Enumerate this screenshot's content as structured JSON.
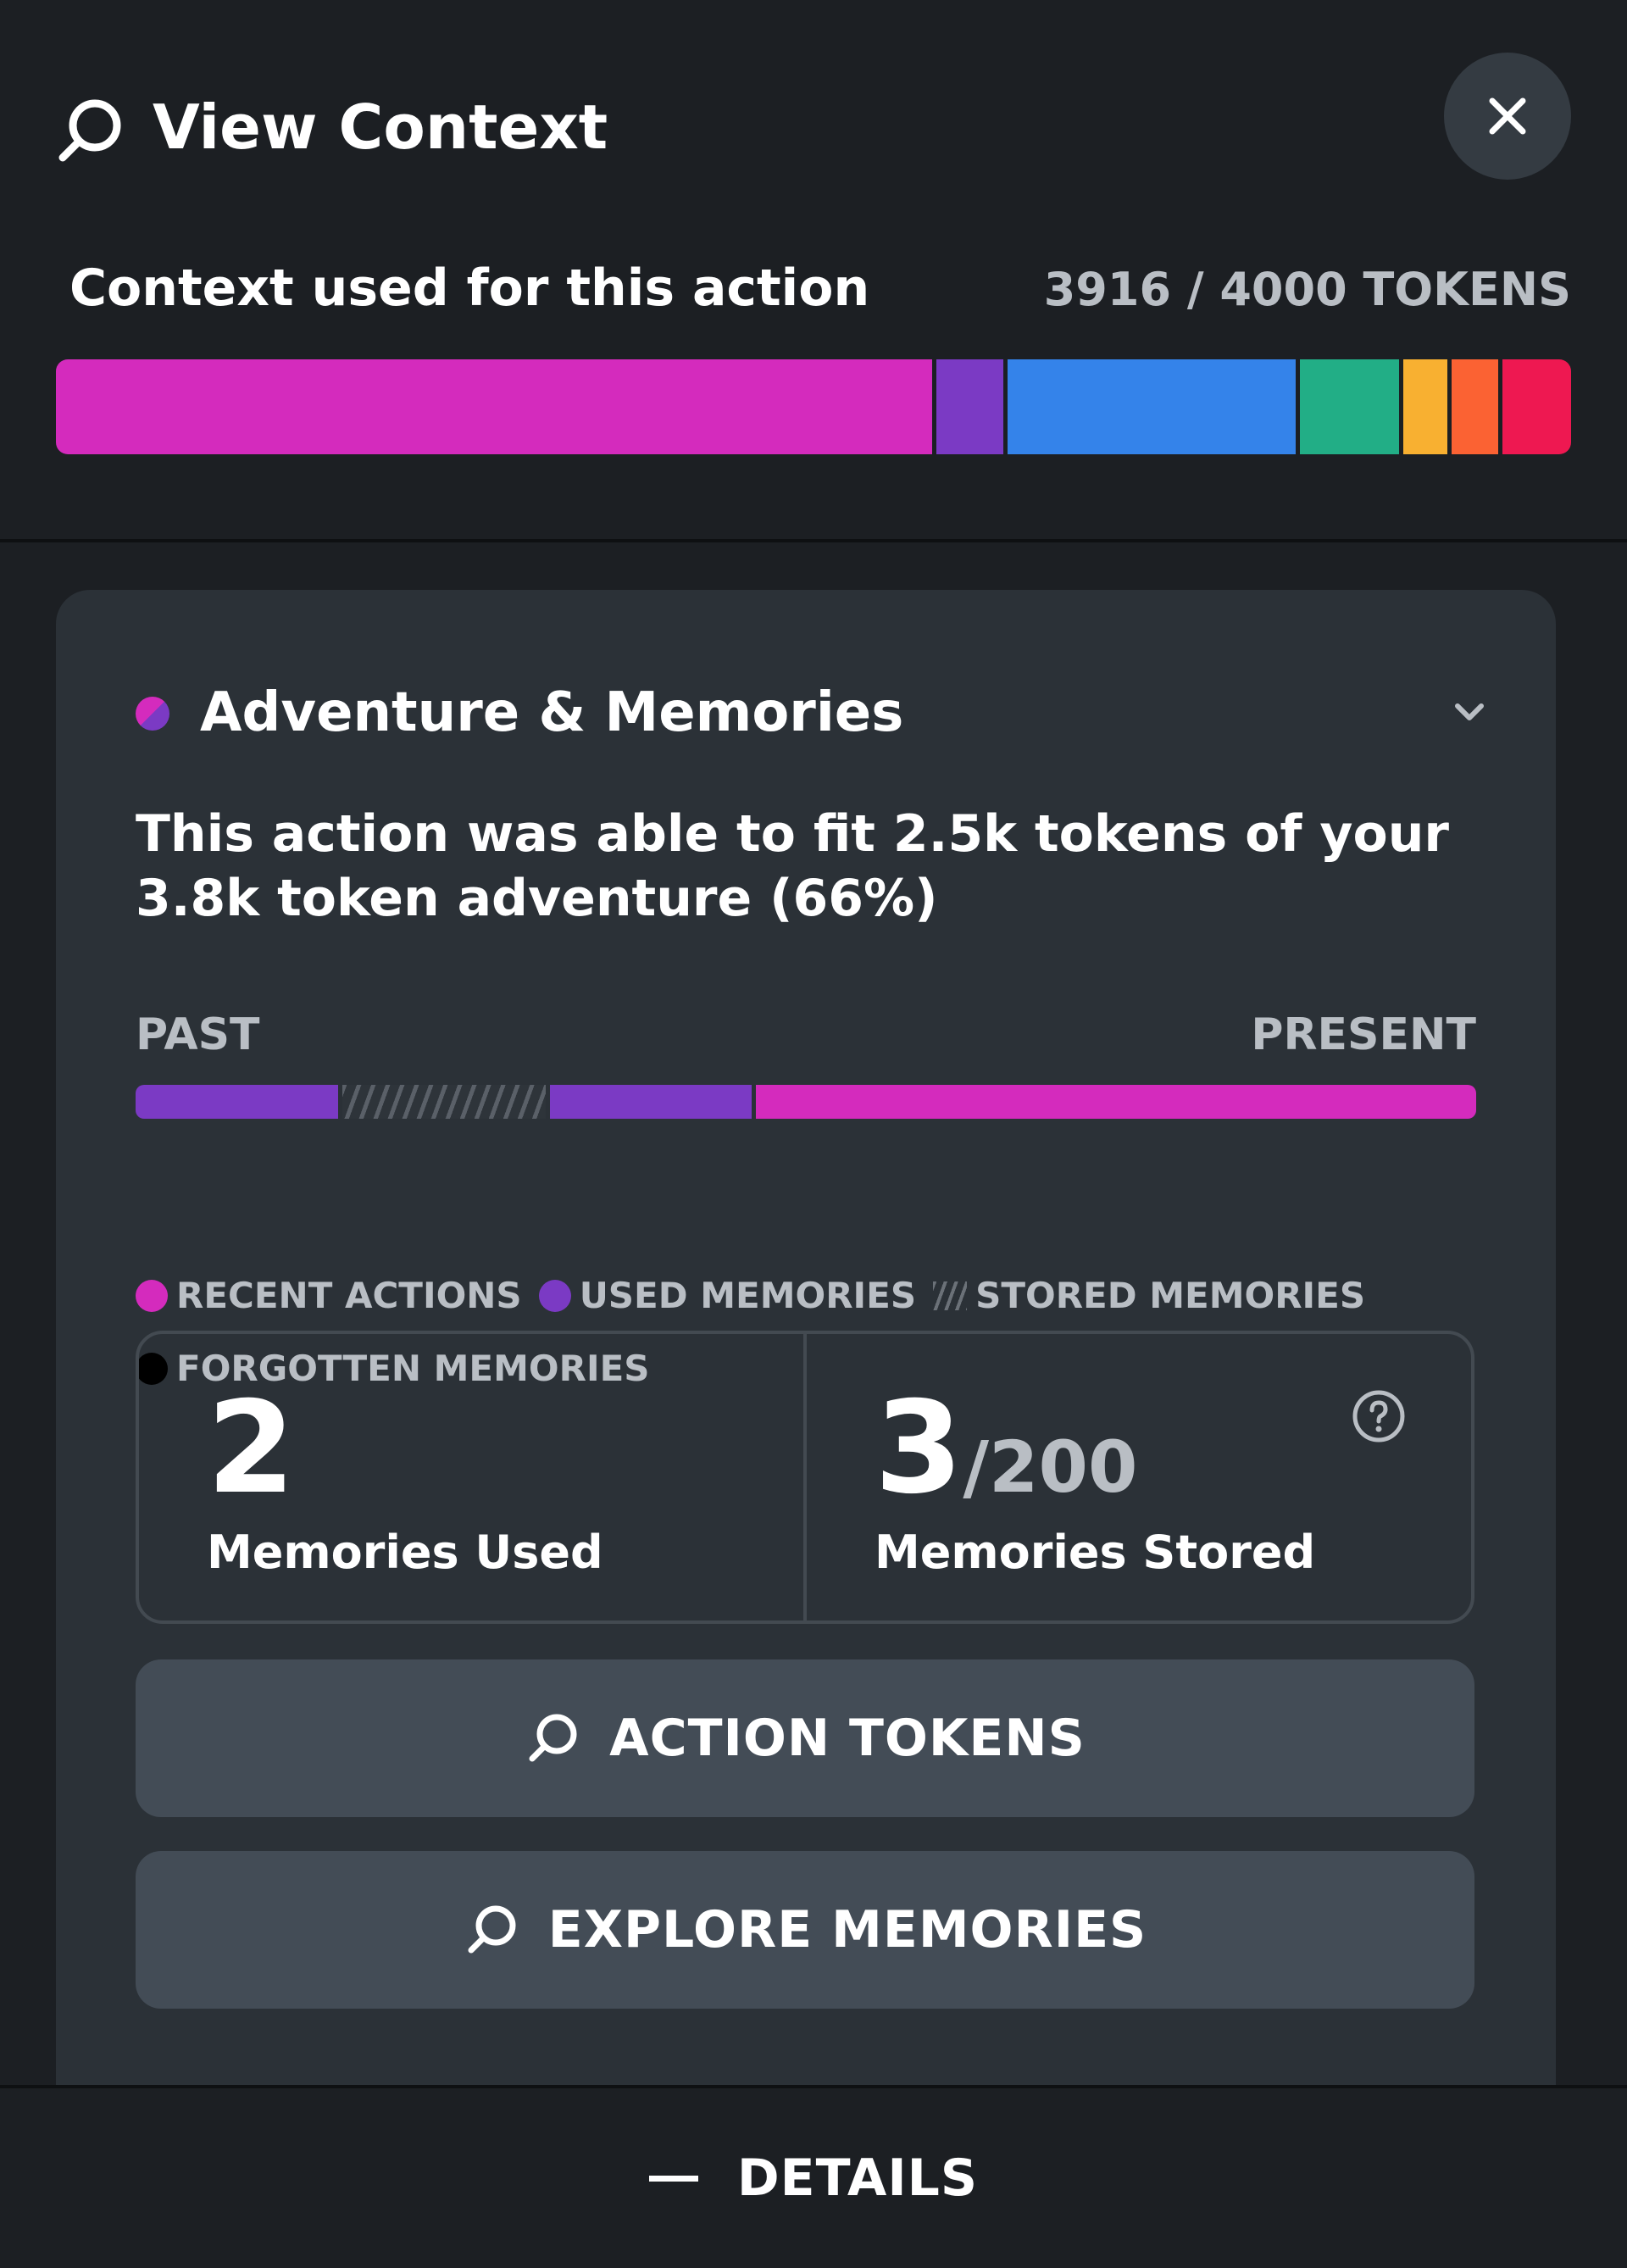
{
  "header": {
    "title": "View Context",
    "title_icon": "search-icon",
    "close_icon": "close-icon"
  },
  "context": {
    "label": "Context used for this action",
    "tokens_text": "3916 / 4000 TOKENS",
    "tokens_used": 3916,
    "tokens_max": 4000,
    "bar_segments": [
      {
        "color": "#d42bbd",
        "fraction": 0.581
      },
      {
        "color": "#7b3ac4",
        "fraction": 0.047
      },
      {
        "color": "#3483ea",
        "fraction": 0.193
      },
      {
        "color": "#22ae86",
        "fraction": 0.068
      },
      {
        "color": "#f8b031",
        "fraction": 0.032
      },
      {
        "color": "#fb6233",
        "fraction": 0.034
      },
      {
        "color": "#ee1851",
        "fraction": 0.045
      }
    ]
  },
  "card": {
    "title": "Adventure & Memories",
    "chevron_icon": "chevron-down-icon",
    "summary": "This action was able to fit 2.5k tokens of your 3.8k token adventure (66%)",
    "timeline_start": "PAST",
    "timeline_end": "PRESENT",
    "timeline_segments": [
      {
        "type": "used",
        "color": "#7b3ac4",
        "fraction": 0.154
      },
      {
        "type": "stored",
        "color": "hatch",
        "fraction": 0.155
      },
      {
        "type": "used",
        "color": "#7b3ac4",
        "fraction": 0.154
      },
      {
        "type": "recent",
        "color": "#d42bbd",
        "fraction": 0.537
      }
    ],
    "legend": {
      "recent": "RECENT ACTIONS",
      "used": "USED MEMORIES",
      "stored": "STORED MEMORIES",
      "forgotten": "FORGOTTEN MEMORIES"
    },
    "legend_colors": {
      "recent": "#d42bbd",
      "used": "#7b3ac4",
      "forgotten": "#000000"
    },
    "stats": {
      "used_count": "2",
      "used_label": "Memories Used",
      "stored_count": "3",
      "stored_max": "/200",
      "stored_label": "Memories Stored",
      "help_icon": "question-circle-icon"
    },
    "buttons": {
      "action_tokens": "ACTION TOKENS",
      "explore_memories": "EXPLORE MEMORIES"
    }
  },
  "footer": {
    "label": "DETAILS"
  }
}
